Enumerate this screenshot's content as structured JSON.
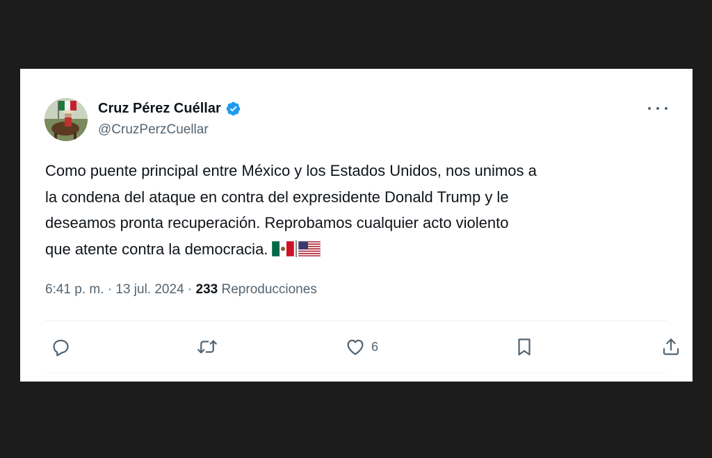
{
  "author": {
    "display_name": "Cruz Pérez Cuéllar",
    "handle": "@CruzPerzCuellar",
    "verified": true
  },
  "tweet": {
    "text_lines": [
      "Como puente principal entre México y los Estados Unidos, nos unimos a",
      "la condena del ataque en contra del expresidente Donald Trump y le",
      "deseamos pronta recuperación. Reprobamos cualquier acto violento",
      "que atente contra la democracia."
    ],
    "flags": [
      "mexico-flag",
      "usa-flag"
    ]
  },
  "meta": {
    "time": "6:41 p. m.",
    "separator": "·",
    "date": "13 jul. 2024",
    "views_count": "233",
    "views_label": "Reproducciones"
  },
  "actions": {
    "likes_count": "6"
  },
  "colors": {
    "background": "#1c1c1c",
    "card": "#ffffff",
    "text_primary": "#0f1419",
    "text_secondary": "#536471",
    "verified_blue": "#1d9bf0",
    "divider": "#eff3f4"
  },
  "icons": [
    "reply-icon",
    "retweet-icon",
    "like-icon",
    "bookmark-icon",
    "share-icon",
    "more-icon",
    "verified-badge-icon"
  ]
}
